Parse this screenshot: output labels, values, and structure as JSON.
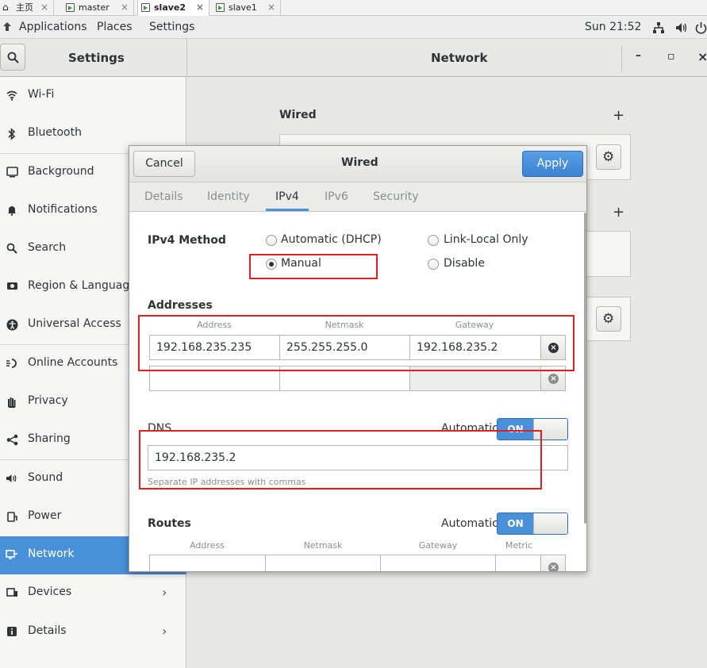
{
  "vm_tabs": {
    "home": "主页",
    "master": "master",
    "slave2": "slave2",
    "slave1": "slave1",
    "close": "×"
  },
  "topbar": {
    "applications": "Applications",
    "places": "Places",
    "settings": "Settings",
    "clock": "Sun 21:52"
  },
  "header": {
    "settings_title": "Settings",
    "network_title": "Network",
    "minimize": "–",
    "maximize": "▫",
    "close": "×"
  },
  "sidebar": {
    "items": [
      {
        "label": "Wi-Fi",
        "icon": "wifi-icon"
      },
      {
        "label": "Bluetooth",
        "icon": "bluetooth-icon"
      },
      {
        "label": "Background",
        "icon": "background-icon"
      },
      {
        "label": "Notifications",
        "icon": "bell-icon"
      },
      {
        "label": "Search",
        "icon": "search-icon"
      },
      {
        "label": "Region & Language",
        "icon": "camera-icon"
      },
      {
        "label": "Universal Access",
        "icon": "accessibility-icon"
      },
      {
        "label": "Online Accounts",
        "icon": "accounts-icon"
      },
      {
        "label": "Privacy",
        "icon": "hand-icon"
      },
      {
        "label": "Sharing",
        "icon": "share-icon"
      },
      {
        "label": "Sound",
        "icon": "speaker-icon"
      },
      {
        "label": "Power",
        "icon": "power-icon"
      },
      {
        "label": "Network",
        "icon": "network-icon"
      },
      {
        "label": "Devices",
        "icon": "devices-icon"
      },
      {
        "label": "Details",
        "icon": "info-icon"
      }
    ],
    "selected": "Network"
  },
  "main": {
    "wired_label": "Wired",
    "add": "+"
  },
  "dialog": {
    "cancel": "Cancel",
    "title": "Wired",
    "apply": "Apply",
    "tabs": [
      "Details",
      "Identity",
      "IPv4",
      "IPv6",
      "Security"
    ],
    "active_tab": "IPv4",
    "ipv4_method_label": "IPv4 Method",
    "methods": {
      "dhcp": "Automatic (DHCP)",
      "link_local": "Link-Local Only",
      "manual": "Manual",
      "disable": "Disable"
    },
    "selected_method": "Manual",
    "addresses_label": "Addresses",
    "address_columns": [
      "Address",
      "Netmask",
      "Gateway"
    ],
    "address_row": {
      "address": "192.168.235.235",
      "netmask": "255.255.255.0",
      "gateway": "192.168.235.2"
    },
    "dns_label": "DNS",
    "dns_automatic_label": "Automatic",
    "dns_switch": "ON",
    "dns_value": "192.168.235.2",
    "dns_hint": "Separate IP addresses with commas",
    "routes_label": "Routes",
    "routes_automatic_label": "Automatic",
    "routes_switch": "ON",
    "route_columns": [
      "Address",
      "Netmask",
      "Gateway",
      "Metric"
    ]
  },
  "colors": {
    "accent": "#4a90d9",
    "highlight_box": "#e02020"
  }
}
